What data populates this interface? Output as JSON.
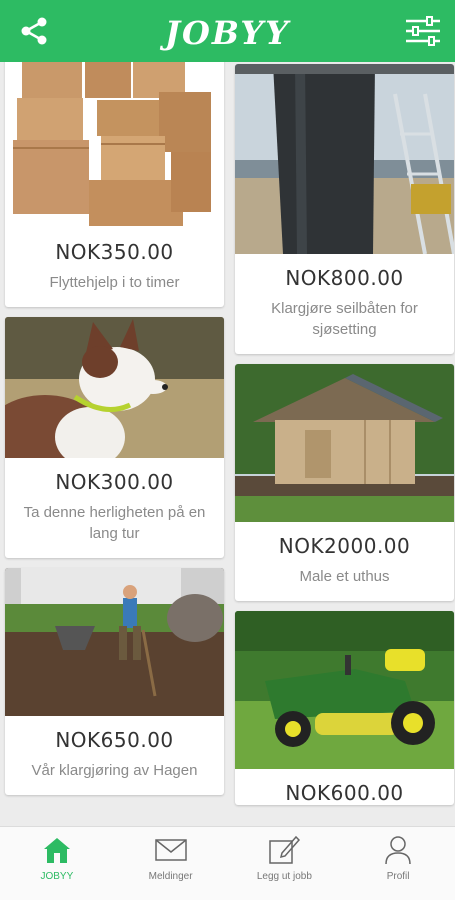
{
  "app": {
    "title": "JOBYY",
    "accent": "#2dbb63"
  },
  "header": {
    "share_icon": "share-icon",
    "filter_icon": "sliders-icon"
  },
  "listings_left": [
    {
      "price": "NOK350.00",
      "description": "Flyttehjelp i to timer",
      "image": "moving-boxes"
    },
    {
      "price": "NOK300.00",
      "description": "Ta denne herligheten på en lang tur",
      "image": "dog"
    },
    {
      "price": "NOK650.00",
      "description": "Vår klargjøring av Hagen",
      "image": "garden-work"
    }
  ],
  "listings_right": [
    {
      "price": "NOK800.00",
      "description": "Klargjøre seilbåten for sjøsetting",
      "image": "sailboat-hull"
    },
    {
      "price": "NOK2000.00",
      "description": "Male et uthus",
      "image": "shed"
    },
    {
      "price": "NOK600.00",
      "description": "",
      "image": "lawn-tractor"
    }
  ],
  "bottom_nav": [
    {
      "label": "JOBYY",
      "icon": "home-icon",
      "active": true
    },
    {
      "label": "Meldinger",
      "icon": "envelope-icon",
      "active": false
    },
    {
      "label": "Legg ut jobb",
      "icon": "edit-icon",
      "active": false
    },
    {
      "label": "Profil",
      "icon": "user-icon",
      "active": false
    }
  ]
}
